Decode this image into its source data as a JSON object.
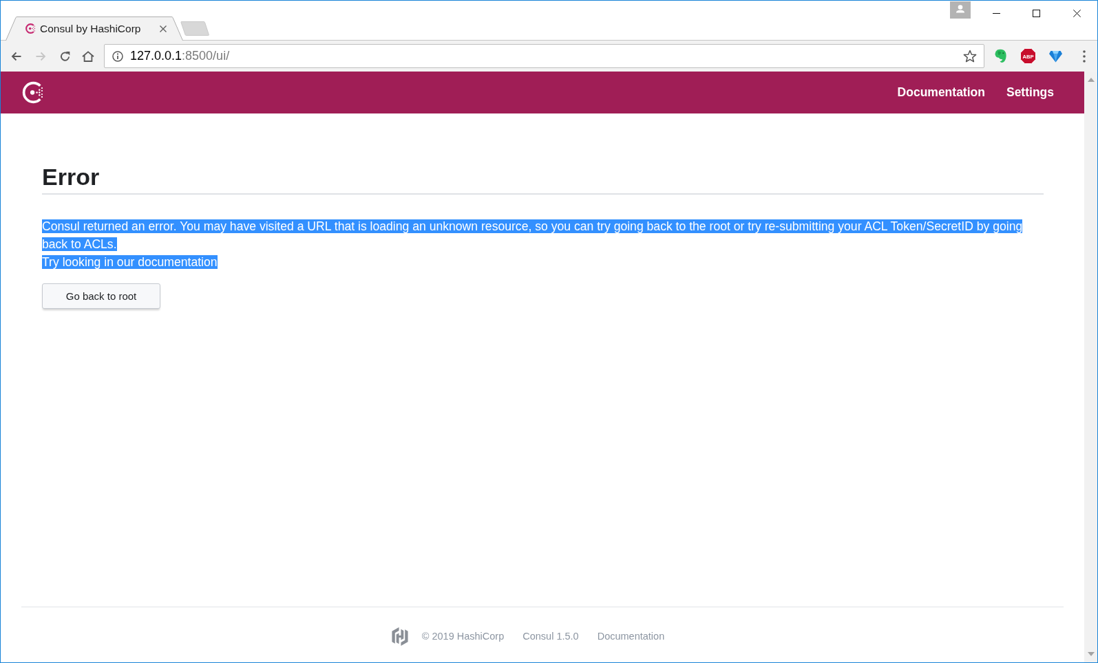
{
  "browser": {
    "tabs": [
      {
        "title": "Consul by HashiCorp",
        "selected": true
      }
    ],
    "forward": {
      "disabled": true
    },
    "address": {
      "host": "127.0.0.1",
      "path": ":8500/ui/"
    },
    "extensions": [
      {
        "kind": "elephant"
      },
      {
        "kind": "stop-sign",
        "label": "ABP"
      },
      {
        "kind": "gem"
      }
    ]
  },
  "header": {
    "nav": [
      "Documentation",
      "Settings"
    ]
  },
  "content": {
    "title": "Error",
    "message": {
      "text": "Consul returned an error. You may have visited a URL that is loading an unknown resource, so you can try going back to the root or try re-submitting your ACL Token/SecretID by going back to ACLs.",
      "selected": true
    },
    "hint": {
      "text": "Try looking in our documentation",
      "selected": true
    },
    "button": "Go back to root"
  },
  "footer": {
    "items": [
      "© 2019 HashiCorp",
      "Consul 1.5.0",
      "Documentation"
    ]
  }
}
